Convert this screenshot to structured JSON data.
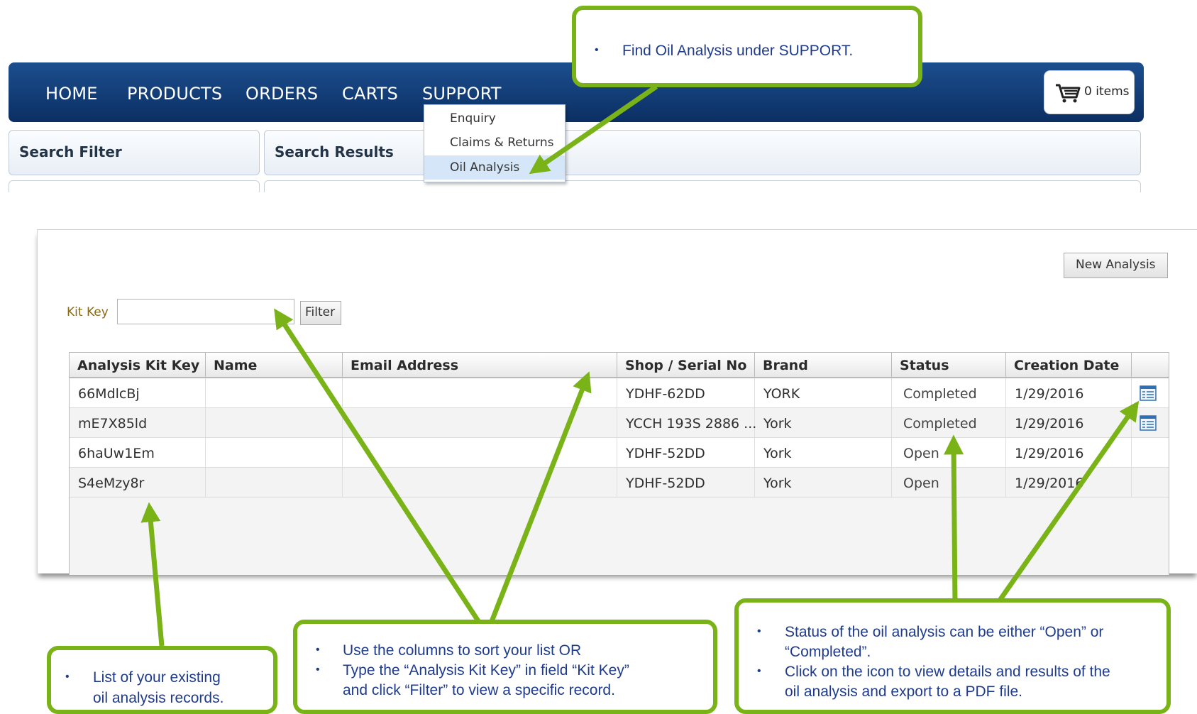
{
  "nav": {
    "items": [
      "HOME",
      "PRODUCTS",
      "ORDERS",
      "CARTS",
      "SUPPORT"
    ],
    "cart_label": "0 items",
    "bar_color": "#0b2f63"
  },
  "support_menu": {
    "items": [
      "Enquiry",
      "Claims & Returns",
      "Oil Analysis"
    ],
    "selected": "Oil Analysis"
  },
  "panels": {
    "filter_title": "Search Filter",
    "results_title": "Search Results"
  },
  "oil_analysis": {
    "new_button": "New Analysis",
    "kit_key_label": "Kit Key",
    "kit_key_value": "",
    "filter_button": "Filter",
    "columns": [
      "Analysis Kit Key",
      "Name",
      "Email Address",
      "Shop / Serial No",
      "Brand",
      "Status",
      "Creation Date",
      ""
    ],
    "sort_column": "Email Address",
    "rows": [
      {
        "kit_key": "66MdlcBj",
        "name": "",
        "email": "",
        "serial": "YDHF-62DD",
        "brand": "YORK",
        "status": "Completed",
        "date": "1/29/2016",
        "has_view_icon": true
      },
      {
        "kit_key": "mE7X85ld",
        "name": "",
        "email": "",
        "serial": "YCCH 193S 2886 ...",
        "brand": "York",
        "status": "Completed",
        "date": "1/29/2016",
        "has_view_icon": true
      },
      {
        "kit_key": "6haUw1Em",
        "name": "",
        "email": "",
        "serial": "YDHF-52DD",
        "brand": "York",
        "status": "Open",
        "date": "1/29/2016",
        "has_view_icon": false
      },
      {
        "kit_key": "S4eMzy8r",
        "name": "",
        "email": "",
        "serial": "YDHF-52DD",
        "brand": "York",
        "status": "Open",
        "date": "1/29/2016",
        "has_view_icon": false
      }
    ]
  },
  "callouts": {
    "support": [
      "Find Oil Analysis under SUPPORT."
    ],
    "records": [
      "List of your existing",
      "oil analysis records."
    ],
    "sort_filter": [
      "Use the columns to sort your list OR",
      "Type the “Analysis Kit Key” in field “Kit Key”",
      "and click “Filter” to view a specific record."
    ],
    "status": [
      "Status of the oil analysis can be either “Open” or",
      "“Completed”.",
      "Click on the icon to view details and results of the",
      "oil analysis and export to a PDF file."
    ],
    "border_color": "#7ab317"
  }
}
